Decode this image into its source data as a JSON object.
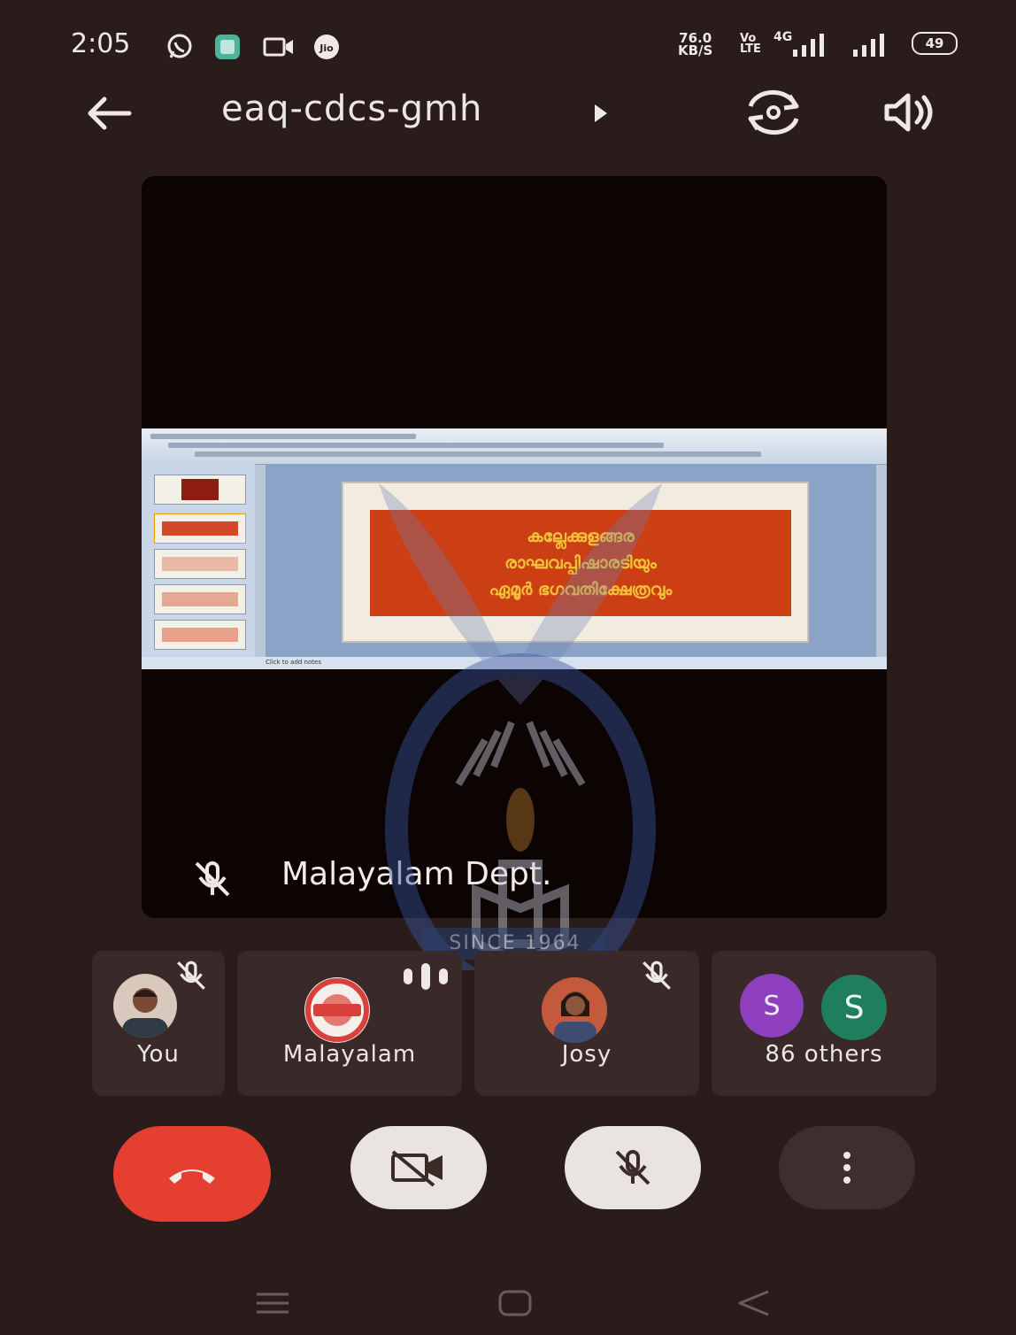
{
  "status_bar": {
    "time": "2:05",
    "network_rate_value": "76.0",
    "network_rate_unit": "KB/S",
    "volte_top": "Vo",
    "volte_bottom": "LTE",
    "network_type": "4G",
    "battery": "49",
    "icons": [
      "whatsapp-icon",
      "app-icon",
      "video-icon",
      "jio-icon",
      "signal-icon",
      "signal-icon",
      "battery-icon"
    ]
  },
  "top_bar": {
    "meeting_code": "eaq-cdcs-gmh",
    "icons": [
      "back-arrow-icon",
      "play-triangle-icon",
      "switch-camera-icon",
      "speaker-icon"
    ]
  },
  "presentation": {
    "slide_lines": [
      "കല്ലേക്കുളങ്ങര",
      "രാഘവപ്പിഷാരടിയും",
      "ഏമൂർ ഭഗവതിക്ഷേത്രവും"
    ],
    "notes_placeholder": "Click to add notes",
    "presenter_name": "Malayalam Dept."
  },
  "watermark": {
    "since": "SINCE 1964"
  },
  "participants": [
    {
      "name": "You",
      "muted": true
    },
    {
      "name": "Malayalam",
      "speaking": true
    },
    {
      "name": "Josy",
      "muted": true
    },
    {
      "name": "86 others",
      "avatars": [
        "S",
        "S"
      ]
    }
  ],
  "colors": {
    "background": "#2a1c1b",
    "end_call": "#e53f32",
    "control_light": "#eae4e1",
    "avatar_purple": "#8e3fbf",
    "avatar_green": "#1f7e5d"
  }
}
